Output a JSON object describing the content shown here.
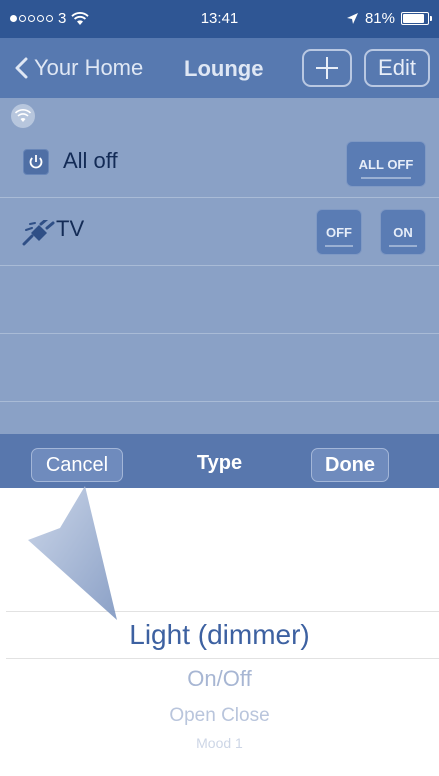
{
  "status_bar": {
    "carrier": "3",
    "time": "13:41",
    "battery": "81%",
    "battery_level": 0.81
  },
  "nav": {
    "back_label": "Your Home",
    "title": "Lounge",
    "add_icon": "plus-icon",
    "edit_label": "Edit"
  },
  "devices": [
    {
      "icon": "power-icon",
      "label": "All off",
      "buttons": [
        "ALL OFF"
      ]
    },
    {
      "icon": "plug-icon",
      "label": "TV",
      "buttons": [
        "OFF",
        "ON"
      ]
    }
  ],
  "picker": {
    "cancel_label": "Cancel",
    "title": "Type",
    "done_label": "Done",
    "selected": "Light (dimmer)",
    "options": [
      "On/Off",
      "Open Close",
      "Mood 1"
    ]
  },
  "colors": {
    "status_bar": "#2f5694",
    "nav_bar": "#5779b0",
    "content": "#8aa1c6",
    "accent": "#3d61a1"
  }
}
